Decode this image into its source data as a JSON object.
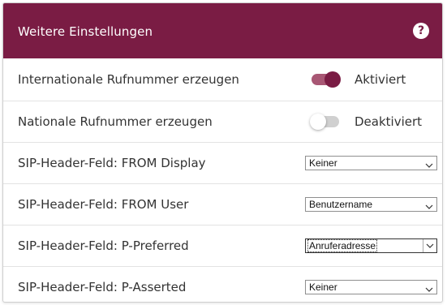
{
  "header": {
    "title": "Weitere Einstellungen",
    "help_glyph": "?"
  },
  "rows": [
    {
      "label": "Internationale Rufnummer erzeugen",
      "state": "on",
      "state_label": "Aktiviert"
    },
    {
      "label": "Nationale Rufnummer erzeugen",
      "state": "off",
      "state_label": "Deaktiviert"
    },
    {
      "label": "SIP-Header-Feld: FROM Display",
      "selected": "Keiner"
    },
    {
      "label": "SIP-Header-Feld: FROM User",
      "selected": "Benutzername"
    },
    {
      "label": "SIP-Header-Feld: P-Preferred",
      "selected": "Anruferadresse"
    },
    {
      "label": "SIP-Header-Feld: P-Asserted",
      "selected": "Keiner"
    }
  ],
  "colors": {
    "accent": "#7a1c44",
    "toggle_track_on": "#a85774",
    "toggle_track_off": "#d0d0d0"
  },
  "icons": {
    "help": "help-icon",
    "dropdown": "chevron-down-icon"
  }
}
